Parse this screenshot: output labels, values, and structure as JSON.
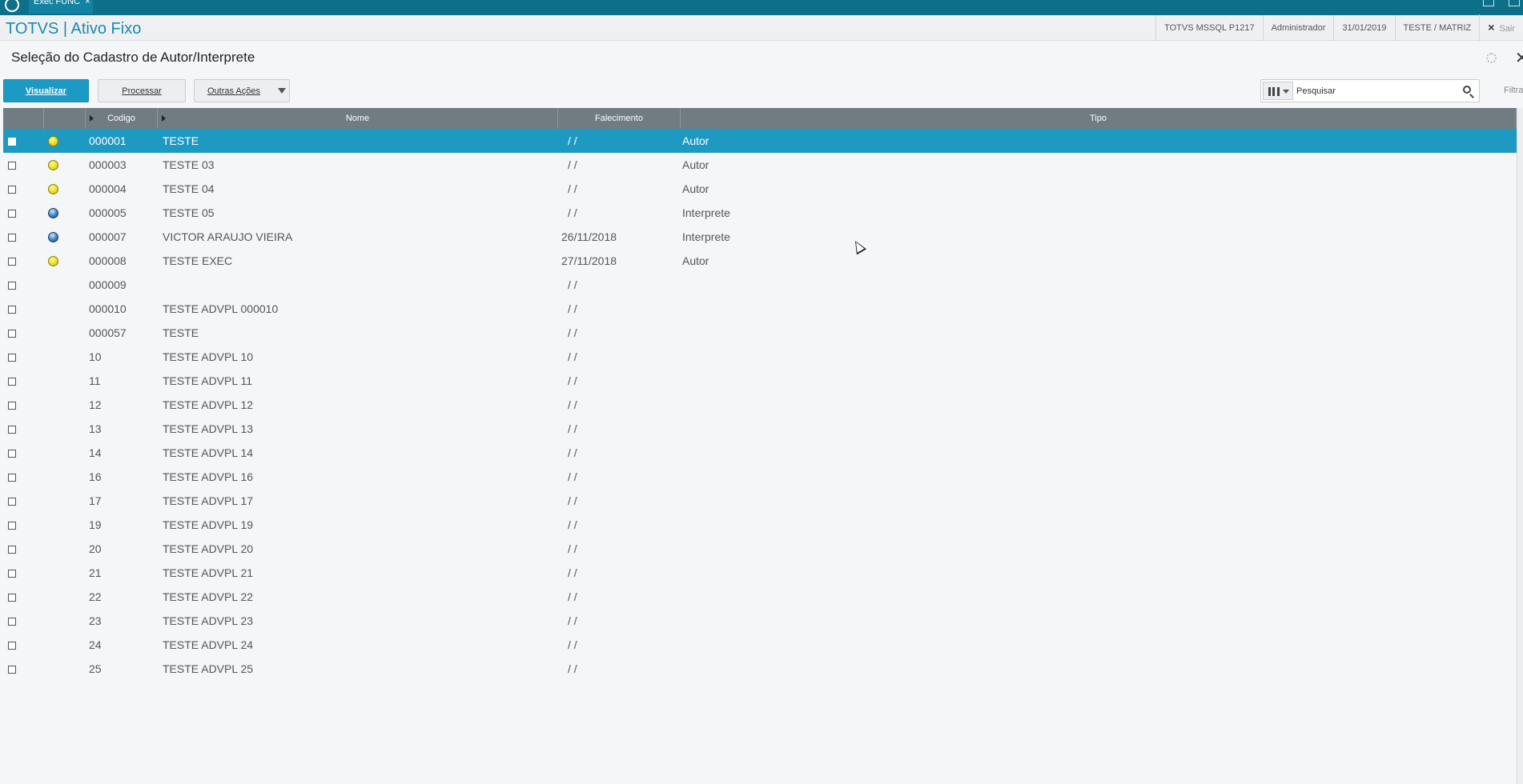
{
  "topbar": {
    "tab_label": "Exec FUNC",
    "tab_close": "×"
  },
  "appbar": {
    "title": "TOTVS | Ativo Fixo",
    "environment": "TOTVS  MSSQL P1217",
    "user": "Administrador",
    "date": "31/01/2019",
    "company": "TESTE / MATRIZ",
    "exit_label": "Sair",
    "exit_icon": "×"
  },
  "page": {
    "title": "Seleção do Cadastro de Autor/Interprete",
    "close_icon": "✕"
  },
  "toolbar": {
    "view_label": "Visualizar",
    "process_label": "Processar",
    "more_label": "Outras Ações"
  },
  "search": {
    "placeholder": "Pesquisar",
    "filter_label": "Filtrar"
  },
  "grid": {
    "columns": [
      "",
      "",
      "Codigo",
      "Nome",
      "Falecimento",
      "Tipo"
    ],
    "status_colors": {
      "yellow": "#e4d81c",
      "blue": "#3e7fc2"
    },
    "rows": [
      {
        "status": "yellow",
        "codigo": "000001",
        "nome": "TESTE",
        "falecimento": "/  /",
        "tipo": "Autor",
        "selected": true
      },
      {
        "status": "yellow",
        "codigo": "000003",
        "nome": "TESTE 03",
        "falecimento": "/  /",
        "tipo": "Autor"
      },
      {
        "status": "yellow",
        "codigo": "000004",
        "nome": "TESTE 04",
        "falecimento": "/  /",
        "tipo": "Autor"
      },
      {
        "status": "blue",
        "codigo": "000005",
        "nome": "TESTE 05",
        "falecimento": "/  /",
        "tipo": "Interprete"
      },
      {
        "status": "blue",
        "codigo": "000007",
        "nome": "VICTOR ARAUJO VIEIRA",
        "falecimento": "26/11/2018",
        "tipo": "Interprete"
      },
      {
        "status": "yellow",
        "codigo": "000008",
        "nome": "TESTE EXEC",
        "falecimento": "27/11/2018",
        "tipo": "Autor"
      },
      {
        "status": "",
        "codigo": "000009",
        "nome": "",
        "falecimento": "/  /",
        "tipo": ""
      },
      {
        "status": "",
        "codigo": "000010",
        "nome": "TESTE ADVPL 000010",
        "falecimento": "/  /",
        "tipo": ""
      },
      {
        "status": "",
        "codigo": "000057",
        "nome": "TESTE",
        "falecimento": "/  /",
        "tipo": ""
      },
      {
        "status": "",
        "codigo": "10",
        "nome": "TESTE ADVPL 10",
        "falecimento": "/  /",
        "tipo": ""
      },
      {
        "status": "",
        "codigo": "11",
        "nome": "TESTE ADVPL 11",
        "falecimento": "/  /",
        "tipo": ""
      },
      {
        "status": "",
        "codigo": "12",
        "nome": "TESTE ADVPL 12",
        "falecimento": "/  /",
        "tipo": ""
      },
      {
        "status": "",
        "codigo": "13",
        "nome": "TESTE ADVPL 13",
        "falecimento": "/  /",
        "tipo": ""
      },
      {
        "status": "",
        "codigo": "14",
        "nome": "TESTE ADVPL 14",
        "falecimento": "/  /",
        "tipo": ""
      },
      {
        "status": "",
        "codigo": "16",
        "nome": "TESTE ADVPL 16",
        "falecimento": "/  /",
        "tipo": ""
      },
      {
        "status": "",
        "codigo": "17",
        "nome": "TESTE ADVPL 17",
        "falecimento": "/  /",
        "tipo": ""
      },
      {
        "status": "",
        "codigo": "19",
        "nome": "TESTE ADVPL 19",
        "falecimento": "/  /",
        "tipo": ""
      },
      {
        "status": "",
        "codigo": "20",
        "nome": "TESTE ADVPL 20",
        "falecimento": "/  /",
        "tipo": ""
      },
      {
        "status": "",
        "codigo": "21",
        "nome": "TESTE ADVPL 21",
        "falecimento": "/  /",
        "tipo": ""
      },
      {
        "status": "",
        "codigo": "22",
        "nome": "TESTE ADVPL 22",
        "falecimento": "/  /",
        "tipo": ""
      },
      {
        "status": "",
        "codigo": "23",
        "nome": "TESTE ADVPL 23",
        "falecimento": "/  /",
        "tipo": ""
      },
      {
        "status": "",
        "codigo": "24",
        "nome": "TESTE ADVPL 24",
        "falecimento": "/  /",
        "tipo": ""
      },
      {
        "status": "",
        "codigo": "25",
        "nome": "TESTE ADVPL 25",
        "falecimento": "/  /",
        "tipo": ""
      }
    ]
  }
}
